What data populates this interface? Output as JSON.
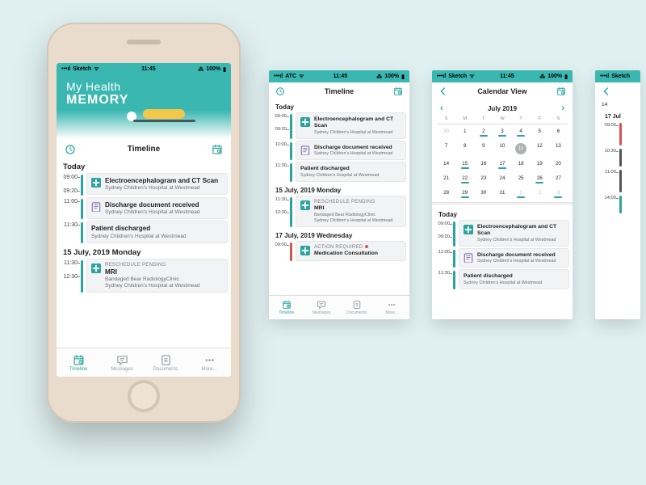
{
  "colors": {
    "teal": "#3ab7b1",
    "tealDark": "#2aa49e",
    "red": "#d9534f",
    "yellow": "#f2c84b"
  },
  "status": {
    "carrier_sketch": "Sketch",
    "carrier_atc": "ATC",
    "time": "11:45",
    "battery": "100%"
  },
  "app": {
    "title_line1": "My Health",
    "title_line2": "MEMORY"
  },
  "screens": {
    "timeline_title": "Timeline",
    "calendar_title": "Calendar View"
  },
  "calendar": {
    "month": "July 2019",
    "weekdays": [
      "S",
      "M",
      "T",
      "W",
      "T",
      "F",
      "S"
    ],
    "rows": [
      [
        {
          "n": 30,
          "o": true
        },
        {
          "n": 1
        },
        {
          "n": 2,
          "u": true
        },
        {
          "n": 3,
          "u": true
        },
        {
          "n": 4,
          "u": true
        },
        {
          "n": 5
        },
        {
          "n": 6
        }
      ],
      [
        {
          "n": 7
        },
        {
          "n": 8
        },
        {
          "n": 9
        },
        {
          "n": 10
        },
        {
          "n": 11,
          "sel": true
        },
        {
          "n": 12
        },
        {
          "n": 13
        }
      ],
      [
        {
          "n": 14
        },
        {
          "n": 15,
          "u": true
        },
        {
          "n": 16
        },
        {
          "n": 17,
          "u": true
        },
        {
          "n": 18
        },
        {
          "n": 19
        },
        {
          "n": 20
        }
      ],
      [
        {
          "n": 21
        },
        {
          "n": 22,
          "u": true
        },
        {
          "n": 23
        },
        {
          "n": 24
        },
        {
          "n": 25
        },
        {
          "n": 26,
          "u": true
        },
        {
          "n": 27
        }
      ],
      [
        {
          "n": 28
        },
        {
          "n": 29,
          "u": true
        },
        {
          "n": 30
        },
        {
          "n": 31
        },
        {
          "n": 1,
          "o": true,
          "u": true
        },
        {
          "n": 2,
          "o": true
        },
        {
          "n": 3,
          "o": true,
          "u": true
        }
      ]
    ]
  },
  "sections": {
    "today": "Today",
    "jul15": "15 July, 2019 Monday",
    "jul17": "17 July, 2019 Wednesday",
    "jul17_short": "17 Jul"
  },
  "events": {
    "eeg": {
      "title": "Electroencephalogram and CT Scan",
      "sub": "Sydney Children's Hospital at Westmead",
      "t": [
        "09:00",
        "09:20"
      ]
    },
    "doc": {
      "title": "Discharge document received",
      "sub": "Sydney Children's Hospital at Westmead",
      "t": [
        "11:00"
      ]
    },
    "dis": {
      "title": "Patient discharged",
      "sub": "Sydney Children's Hospital at Westmead",
      "t": [
        "11:30"
      ]
    },
    "mri": {
      "tag": "RESCHEDULE PENDING",
      "title": "MRI",
      "sub1": "Bandaged Bear RadiologyClinic",
      "sub2": "Sydney Children's Hospital at Westmead",
      "t": [
        "11:30",
        "12:30"
      ]
    },
    "med": {
      "tag": "ACTION REQUIRED",
      "title": "Medication Consultation",
      "t": [
        "09:00"
      ]
    }
  },
  "p4": {
    "t1": "09:00",
    "t2": "10:30",
    "t3": "11:00",
    "t4": "14:00",
    "n": "14"
  },
  "tabs": {
    "timeline": "Timeline",
    "messages": "Messages",
    "documents": "Documents",
    "more": "More..."
  }
}
